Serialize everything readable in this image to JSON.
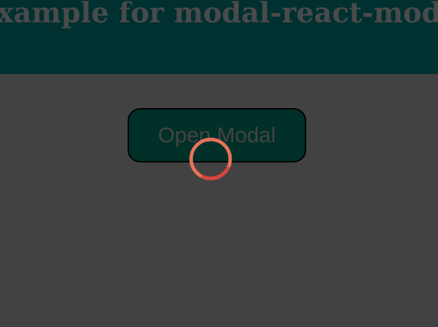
{
  "header": {
    "title": "Example for modal-react-module"
  },
  "main": {
    "open_modal_label": "Open Modal"
  },
  "spinner": {
    "icon": "loading-spinner-icon",
    "colors": {
      "ring": "#e8735a",
      "arc": "#d9443f"
    }
  },
  "colors": {
    "background": "#424242",
    "header_background": "#003030",
    "button_background": "#003028"
  }
}
